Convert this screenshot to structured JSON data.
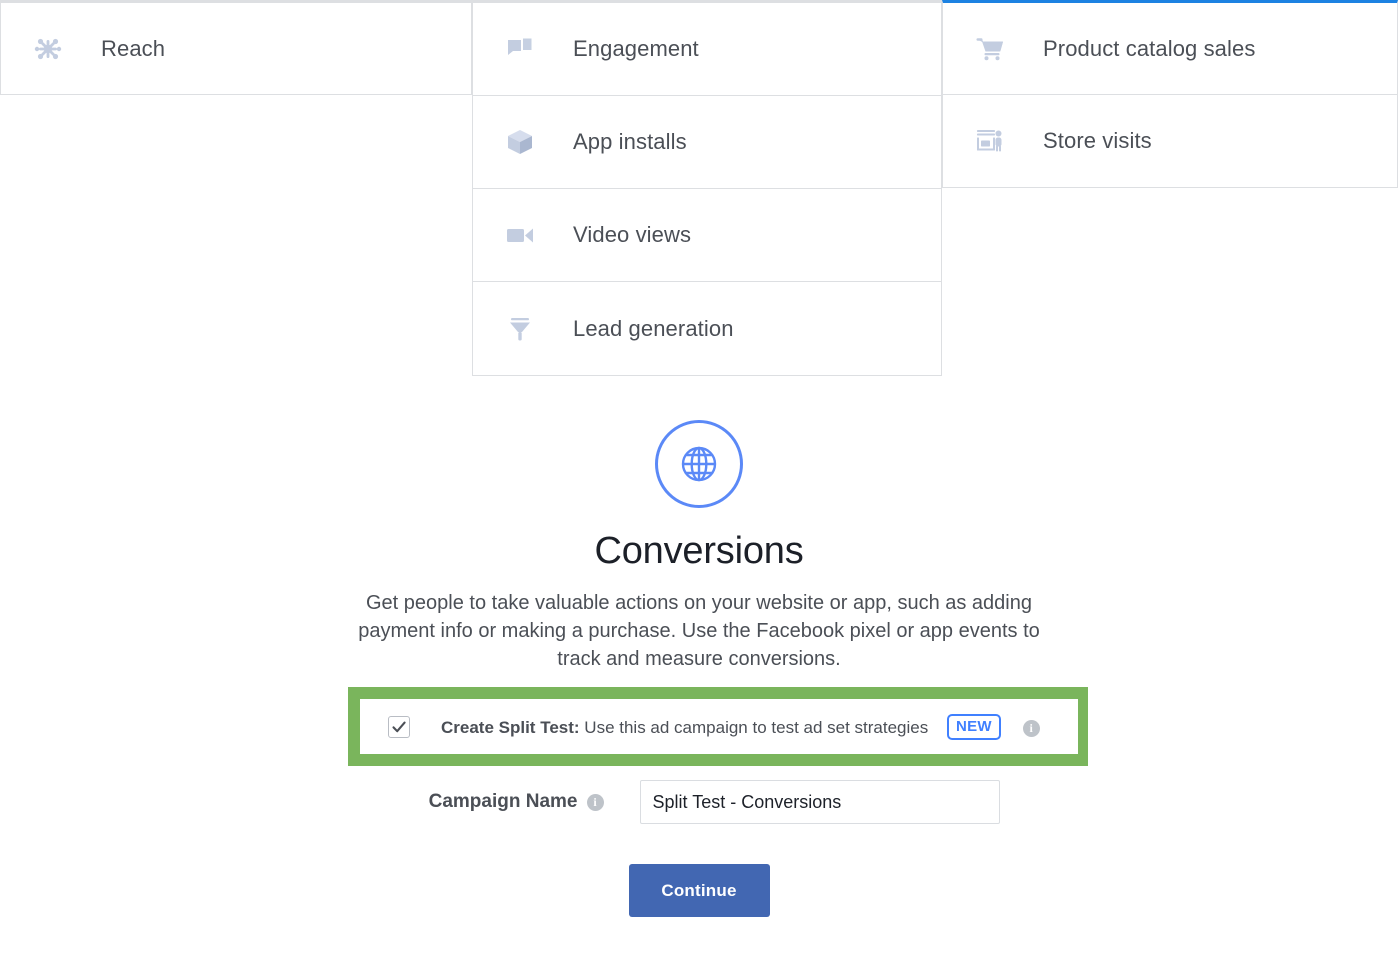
{
  "objective_columns": [
    {
      "id": "column-left",
      "active": false,
      "items": [
        {
          "label": "Reach",
          "icon": "reach-icon"
        }
      ]
    },
    {
      "id": "column-middle",
      "active": false,
      "items": [
        {
          "label": "Engagement",
          "icon": "engagement-icon"
        },
        {
          "label": "App installs",
          "icon": "app-installs-icon"
        },
        {
          "label": "Video views",
          "icon": "video-views-icon"
        },
        {
          "label": "Lead generation",
          "icon": "lead-generation-icon"
        }
      ]
    },
    {
      "id": "column-right",
      "active": true,
      "items": [
        {
          "label": "Product catalog sales",
          "icon": "shopping-cart-icon"
        },
        {
          "label": "Store visits",
          "icon": "store-visits-icon"
        }
      ]
    }
  ],
  "hero": {
    "icon": "globe-icon",
    "title": "Conversions",
    "description": "Get people to take valuable actions on your website or app, such as adding payment info or making a purchase. Use the Facebook pixel or app events to track and measure conversions."
  },
  "split_test": {
    "checked": true,
    "checkmark": "✓",
    "label_bold": "Create Split Test:",
    "label_rest": " Use this ad campaign to test ad set strategies",
    "badge": "NEW",
    "info_glyph": "i",
    "highlight_color": "#7ab55c",
    "badge_color": "#4080ff"
  },
  "campaign": {
    "label": "Campaign Name",
    "info_glyph": "i",
    "value": "Split Test - Conversions",
    "placeholder": "Campaign Name"
  },
  "continue": {
    "label": "Continue",
    "color": "#4267b2"
  },
  "colors": {
    "active_column_border": "#1d82e2",
    "inactive_column_border": "#dddfe2",
    "icon_fill": "#c3cde0",
    "hero_accent": "#5b89f7"
  }
}
